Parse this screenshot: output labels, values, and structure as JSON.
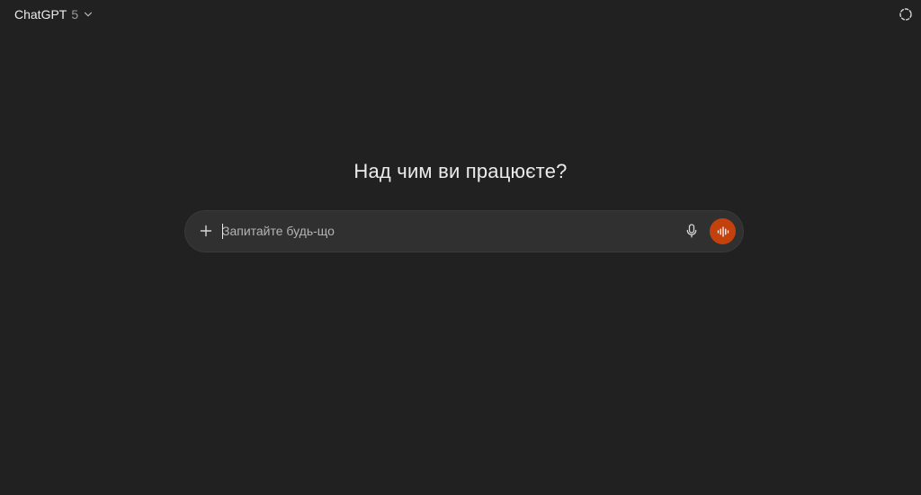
{
  "header": {
    "model_name": "ChatGPT",
    "model_version": "5",
    "chevron_icon": "chevron-down-icon",
    "temporary_chat_icon": "dashed-circle-icon"
  },
  "main": {
    "heading": "Над чим ви працюєте?"
  },
  "composer": {
    "placeholder": "Запитайте будь-що",
    "value": "",
    "plus_icon": "plus-icon",
    "mic_icon": "microphone-icon",
    "voice_icon": "voice-waveform-icon"
  },
  "colors": {
    "background": "#212121",
    "composer_background": "#303030",
    "voice_button": "#c2410c",
    "text": "#ececec"
  }
}
